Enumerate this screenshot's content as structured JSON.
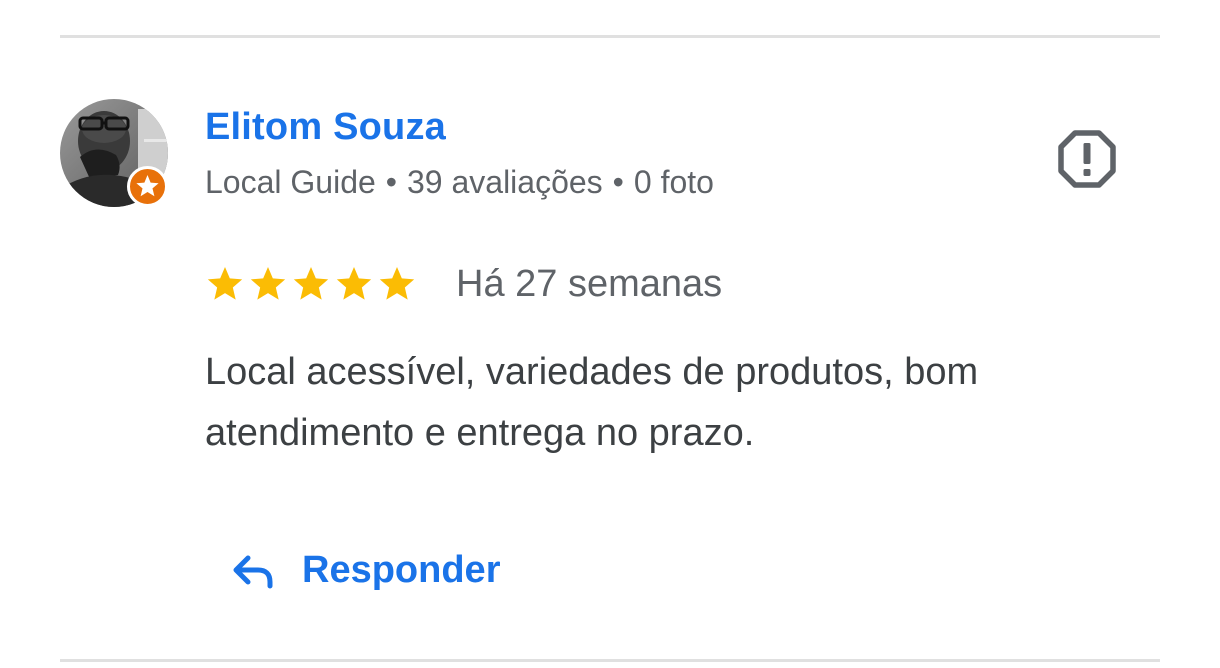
{
  "review": {
    "author": {
      "name": "Elitom Souza",
      "badge": "Local Guide",
      "separator": "•",
      "review_count": "39 avaliações",
      "photo_count": "0 foto",
      "avatar_icon": "user-photo",
      "badge_icon": "star-badge-icon",
      "badge_color": "#e8710a"
    },
    "rating": {
      "stars": 5,
      "max_stars": 5,
      "star_color": "#fbbc04",
      "time": "Há 27 semanas"
    },
    "text_lines": [
      "Local acessível, variedades de produtos, bom",
      "atendimento e entrega no prazo."
    ],
    "actions": {
      "report_icon": "report-octagon-icon",
      "reply_icon": "reply-arrow-icon",
      "reply_label": "Responder"
    }
  },
  "colors": {
    "link": "#1a73e8",
    "secondary_text": "#5f6368",
    "body_text": "#3c4043",
    "divider": "#e0e0e0"
  }
}
